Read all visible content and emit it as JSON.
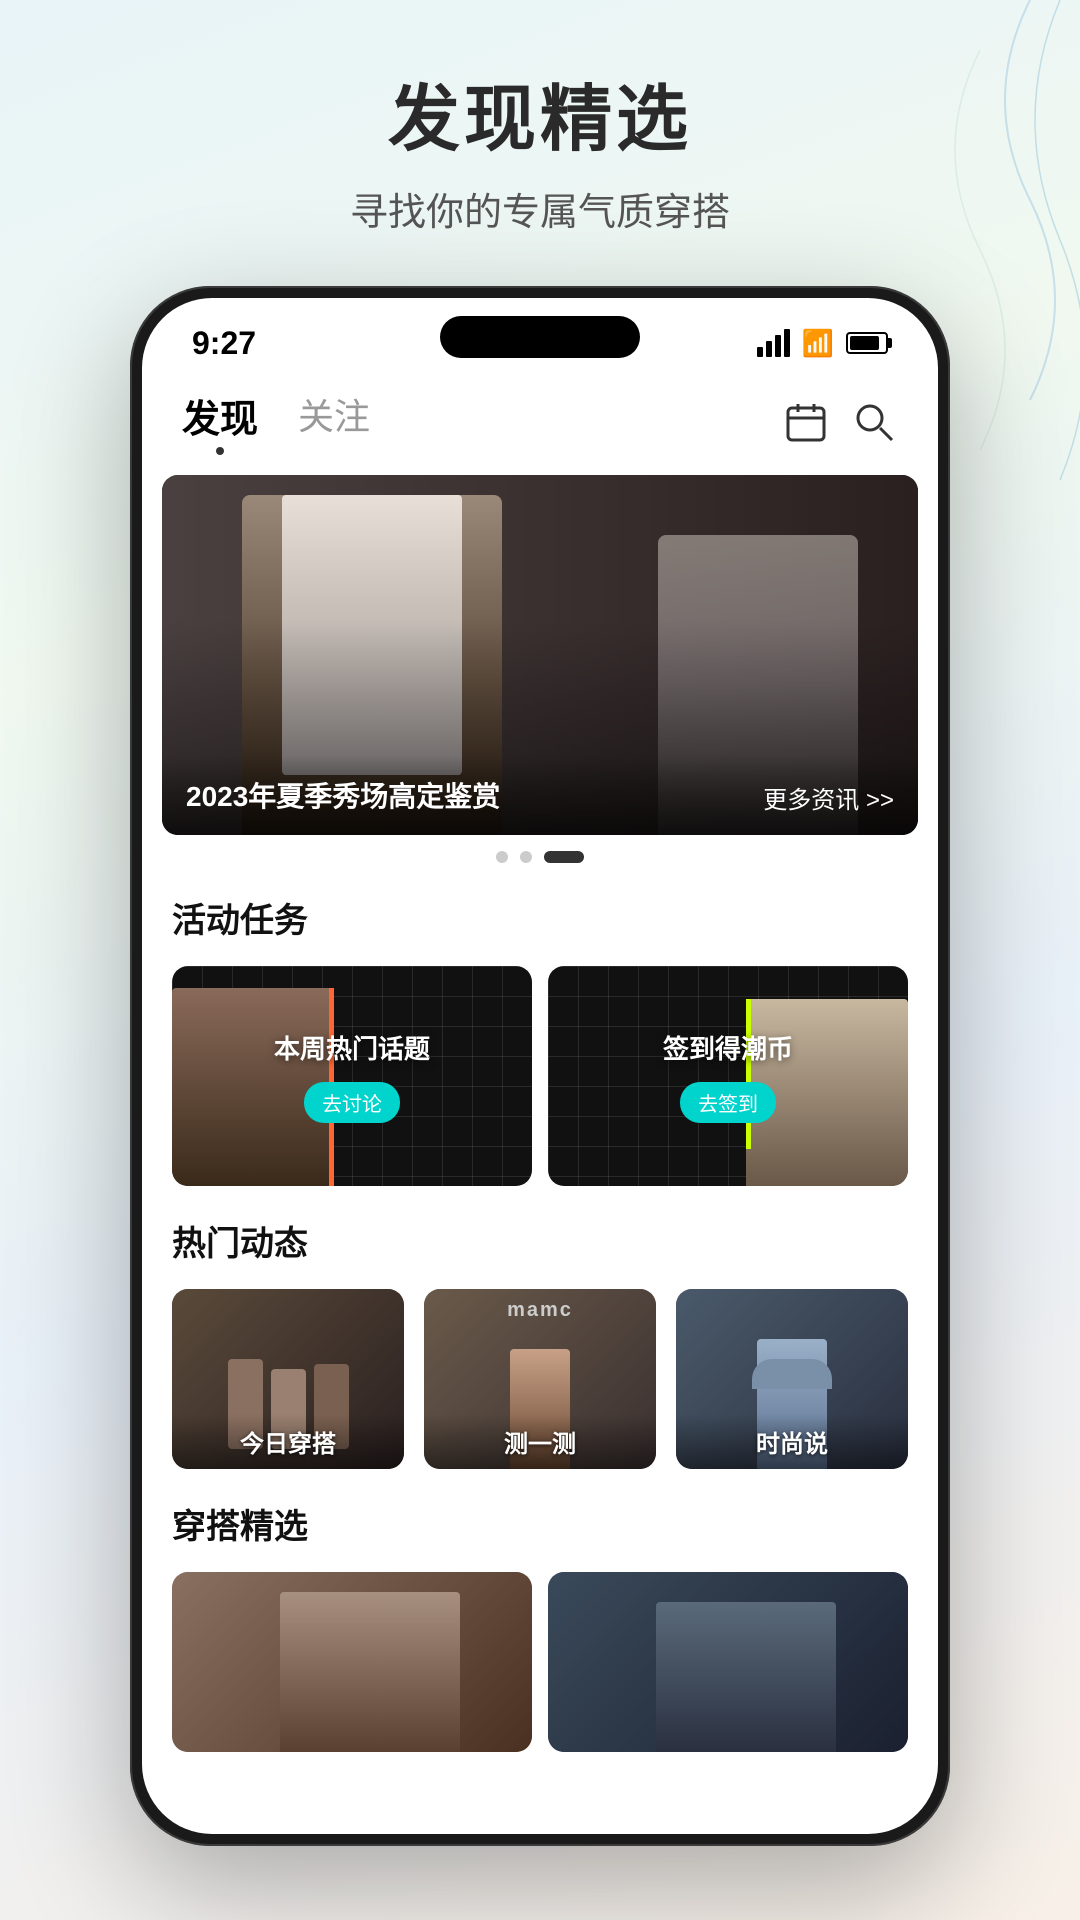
{
  "page": {
    "background_title": "发现精选",
    "background_subtitle": "寻找你的专属气质穿搭"
  },
  "status_bar": {
    "time": "9:27",
    "signal": "signal",
    "wifi": "wifi",
    "battery": "battery"
  },
  "nav": {
    "tabs": [
      {
        "id": "discover",
        "label": "发现",
        "active": true
      },
      {
        "id": "follow",
        "label": "关注",
        "active": false
      }
    ],
    "calendar_icon": "calendar",
    "search_icon": "search"
  },
  "banner": {
    "title": "2023年夏季秀场高定鉴赏",
    "more_label": "更多资讯 >>",
    "dots": [
      {
        "active": false
      },
      {
        "active": false
      },
      {
        "active": true
      }
    ]
  },
  "activity_section": {
    "title": "活动任务",
    "cards": [
      {
        "id": "hot-topic",
        "text": "本周热门话题",
        "btn_label": "去讨论",
        "btn_color": "#00d4cc"
      },
      {
        "id": "check-in",
        "text": "签到得潮币",
        "btn_label": "去签到",
        "btn_color": "#00d4cc"
      }
    ]
  },
  "dynamics_section": {
    "title": "热门动态",
    "items": [
      {
        "id": "daily-outfit",
        "label": "今日穿搭"
      },
      {
        "id": "test",
        "label": "测一测"
      },
      {
        "id": "fashion-talk",
        "label": "时尚说"
      }
    ]
  },
  "outfit_section": {
    "title": "穿搭精选",
    "items": [
      {
        "id": "outfit-1"
      },
      {
        "id": "outfit-2"
      }
    ]
  }
}
